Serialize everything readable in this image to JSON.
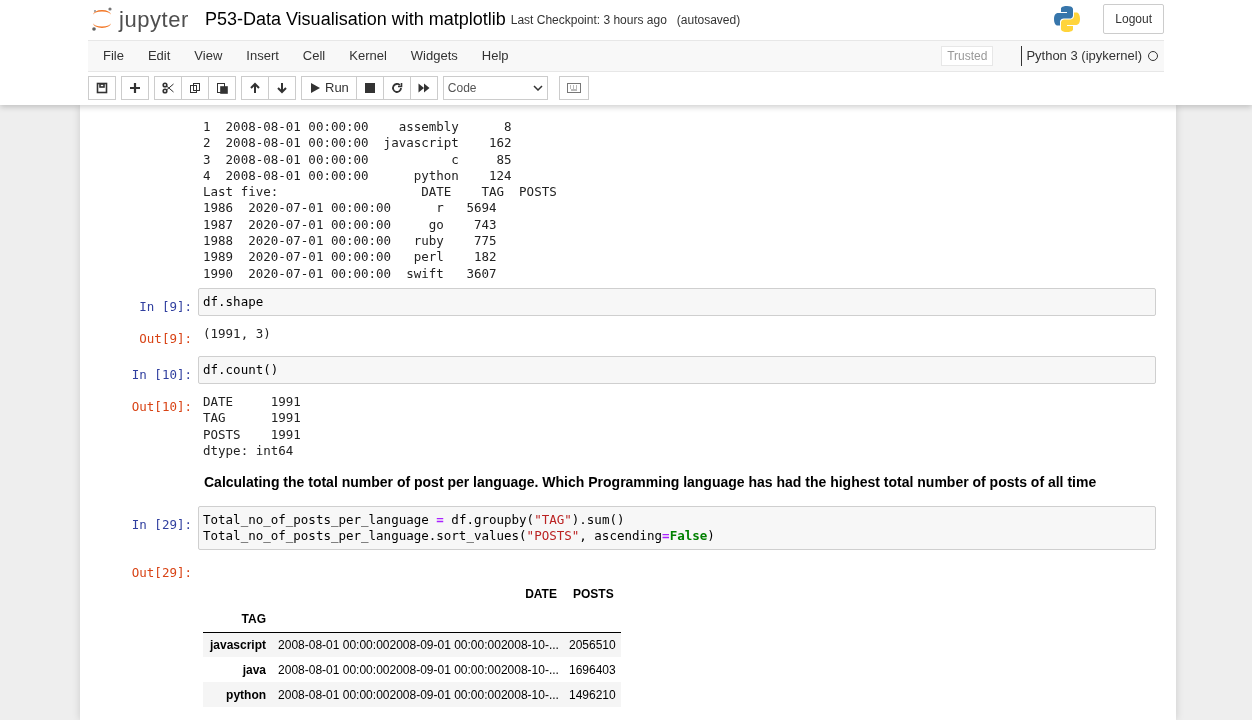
{
  "header": {
    "logo_text": "jupyter",
    "notebook_title": "P53-Data Visualisation with matplotlib",
    "checkpoint": "Last Checkpoint: 3 hours ago",
    "autosave": "(autosaved)",
    "logout": "Logout"
  },
  "menu": [
    "File",
    "Edit",
    "View",
    "Insert",
    "Cell",
    "Kernel",
    "Widgets",
    "Help"
  ],
  "trusted": "Trusted",
  "kernel": {
    "name": "Python 3 (ipykernel)",
    "busy": false
  },
  "toolbar": {
    "run": "Run",
    "cell_type": "Code"
  },
  "cells": [
    {
      "kind": "output_text",
      "lines": [
        "1  2008-08-01 00:00:00    assembly      8",
        "2  2008-08-01 00:00:00  javascript    162",
        "3  2008-08-01 00:00:00           c     85",
        "4  2008-08-01 00:00:00      python    124",
        "Last five:                   DATE    TAG  POSTS",
        "1986  2020-07-01 00:00:00      r   5694",
        "1987  2020-07-01 00:00:00     go    743",
        "1988  2020-07-01 00:00:00   ruby    775",
        "1989  2020-07-01 00:00:00   perl    182",
        "1990  2020-07-01 00:00:00  swift   3607"
      ]
    },
    {
      "kind": "input",
      "prompt": "In [9]:",
      "lines": [
        [
          {
            "text": "df.shape",
            "kind": "plain"
          }
        ]
      ]
    },
    {
      "kind": "output_text",
      "prompt": "Out[9]:",
      "lines": [
        "(1991, 3)"
      ]
    },
    {
      "kind": "input",
      "prompt": "In [10]:",
      "lines": [
        [
          {
            "text": "df.count()",
            "kind": "plain"
          }
        ]
      ]
    },
    {
      "kind": "output_text",
      "prompt": "Out[10]:",
      "lines": [
        "DATE     1991",
        "TAG      1991",
        "POSTS    1991",
        "dtype: int64"
      ]
    },
    {
      "kind": "markdown",
      "text": "Calculating the total number of post per language. Which Programming language has had the highest total number of posts of all time"
    },
    {
      "kind": "input",
      "prompt": "In [29]:",
      "lines": [
        [
          {
            "text": "Total_no_of_posts_per_language ",
            "kind": "plain"
          },
          {
            "text": "=",
            "kind": "operator"
          },
          {
            "text": " df.groupby(",
            "kind": "plain"
          },
          {
            "text": "\"TAG\"",
            "kind": "string"
          },
          {
            "text": ").sum()",
            "kind": "plain"
          }
        ],
        [
          {
            "text": "Total_no_of_posts_per_language.sort_values(",
            "kind": "plain"
          },
          {
            "text": "\"POSTS\"",
            "kind": "string"
          },
          {
            "text": ", ascending",
            "kind": "plain"
          },
          {
            "text": "=",
            "kind": "operator"
          },
          {
            "text": "False",
            "kind": "keyword"
          },
          {
            "text": ")",
            "kind": "plain"
          }
        ]
      ]
    },
    {
      "kind": "output_table",
      "prompt": "Out[29]:",
      "columns": [
        "DATE",
        "POSTS"
      ],
      "index_name": "TAG",
      "rows": [
        {
          "index": "javascript",
          "cells": [
            "2008-08-01 00:00:002008-09-01 00:00:002008-10-...",
            "2056510"
          ]
        },
        {
          "index": "java",
          "cells": [
            "2008-08-01 00:00:002008-09-01 00:00:002008-10-...",
            "1696403"
          ]
        },
        {
          "index": "python",
          "cells": [
            "2008-08-01 00:00:002008-09-01 00:00:002008-10-...",
            "1496210"
          ]
        }
      ]
    }
  ]
}
